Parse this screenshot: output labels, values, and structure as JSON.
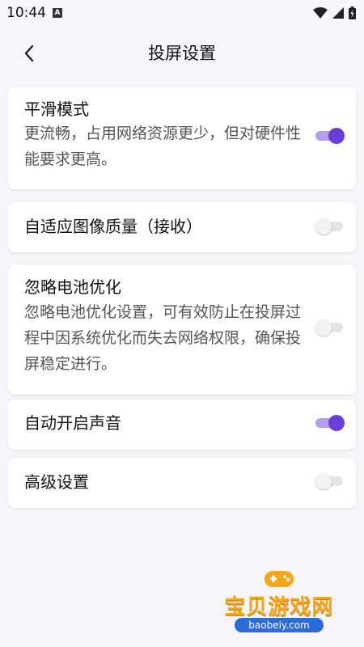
{
  "status_bar": {
    "time": "10:44",
    "notification_icon": "A"
  },
  "header": {
    "title": "投屏设置"
  },
  "settings": [
    {
      "title": "平滑模式",
      "description": "更流畅，占用网络资源更少，但对硬件性能要求更高。",
      "enabled": true
    },
    {
      "title": "自适应图像质量（接收）",
      "description": "",
      "enabled": false
    },
    {
      "title": "忽略电池优化",
      "description": "忽略电池优化设置，可有效防止在投屏过程中因系统优化而失去网络权限，确保投屏稳定进行。",
      "enabled": false
    },
    {
      "title": "自动开启声音",
      "description": "",
      "enabled": true
    },
    {
      "title": "高级设置",
      "description": "",
      "enabled": false
    }
  ],
  "watermark": {
    "text": "宝贝游戏网",
    "url": "baobeiy.com"
  },
  "colors": {
    "accent": "#6a3fd8",
    "accent_track": "#b79cf0",
    "background": "#f5f5fa",
    "card": "#ffffff"
  }
}
